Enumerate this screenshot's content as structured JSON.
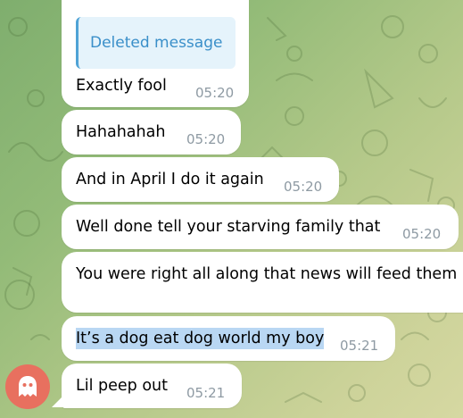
{
  "colors": {
    "bubble": "#ffffff",
    "reply_accent": "#4fa3d6",
    "reply_bg": "#e5f3fb",
    "time": "#8e9aa3",
    "selection": "#b9d7f3",
    "avatar_bg": "#e8705f"
  },
  "messages": [
    {
      "text": "Exactly fool",
      "time": "05:20",
      "reply": "Deleted message"
    },
    {
      "text": "Hahahahah",
      "time": "05:20"
    },
    {
      "text": "And in April I do it again",
      "time": "05:20"
    },
    {
      "text": "Well done tell your starving family that",
      "time": "05:20"
    },
    {
      "text": "You were right all along that news will feed them",
      "time": ""
    },
    {
      "text": "It’s a dog eat dog world my boy",
      "time": "05:21",
      "selected": true
    },
    {
      "text": "Lil peep out",
      "time": "05:21"
    }
  ],
  "avatar": {
    "icon": "ghost-icon"
  }
}
